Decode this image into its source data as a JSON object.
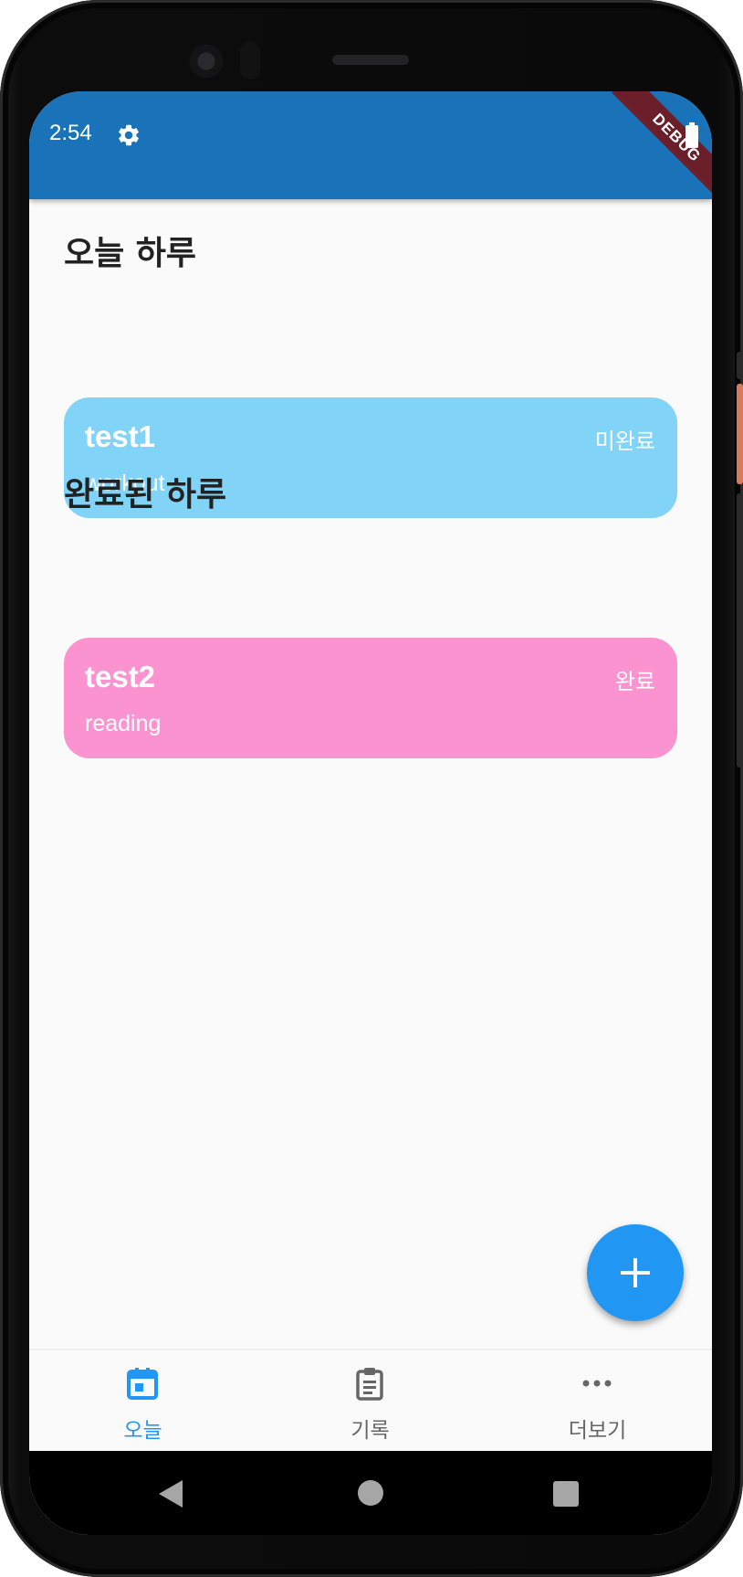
{
  "status_bar": {
    "time": "2:54",
    "debug_banner": "DEBUG"
  },
  "sections": {
    "today_title": "오늘 하루",
    "completed_title": "완료된 하루"
  },
  "today_items": [
    {
      "title": "test1",
      "subtitle": "workout",
      "status": "미완료",
      "color": "#81d3f8"
    }
  ],
  "completed_items": [
    {
      "title": "test2",
      "subtitle": "reading",
      "status": "완료",
      "color": "#fb93d1"
    }
  ],
  "fab": {
    "icon": "plus-icon"
  },
  "bottom_nav": {
    "items": [
      {
        "label": "오늘",
        "icon": "calendar-icon",
        "active": true
      },
      {
        "label": "기록",
        "icon": "clipboard-icon",
        "active": false
      },
      {
        "label": "더보기",
        "icon": "more-horiz-icon",
        "active": false
      }
    ]
  },
  "colors": {
    "app_bar": "#1a73b8",
    "accent": "#2196f3",
    "background": "#fafafa"
  }
}
